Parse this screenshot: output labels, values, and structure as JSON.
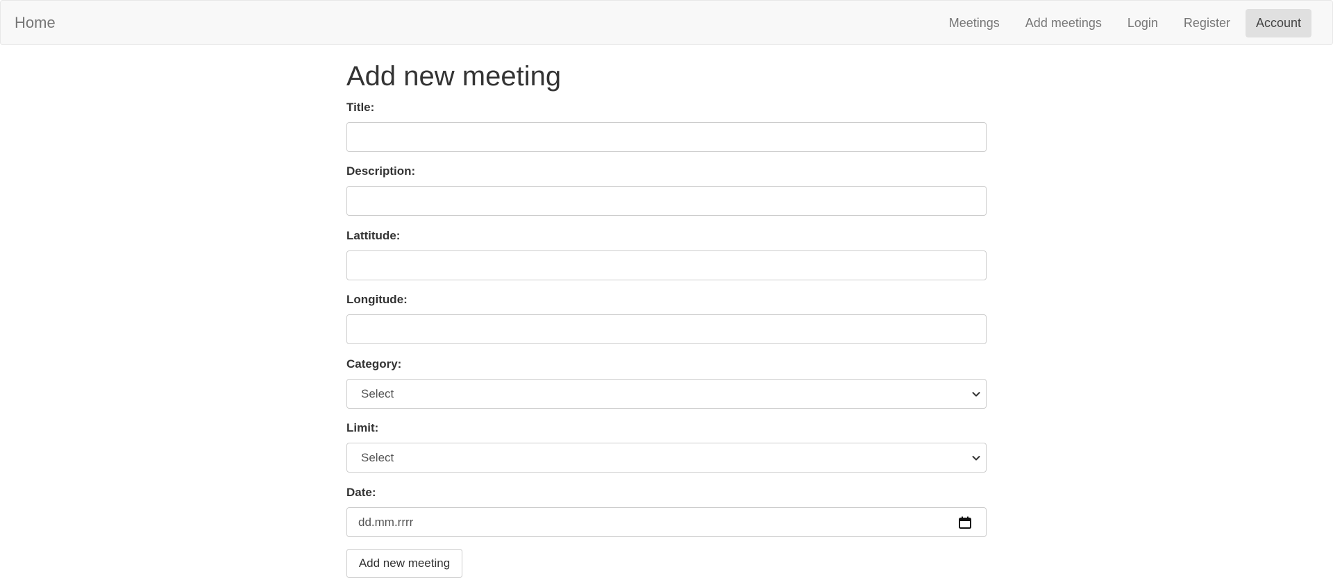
{
  "navbar": {
    "brand": "Home",
    "links": [
      {
        "label": "Meetings"
      },
      {
        "label": "Add meetings"
      },
      {
        "label": "Login"
      },
      {
        "label": "Register"
      },
      {
        "label": "Account",
        "active": true
      }
    ]
  },
  "form": {
    "heading": "Add new meeting",
    "fields": {
      "title": {
        "label": "Title:",
        "value": ""
      },
      "description": {
        "label": "Description:",
        "value": ""
      },
      "latitude": {
        "label": "Lattitude:",
        "value": ""
      },
      "longitude": {
        "label": "Longitude:",
        "value": ""
      },
      "category": {
        "label": "Category:",
        "selected": "Select"
      },
      "limit": {
        "label": "Limit:",
        "selected": "Select"
      },
      "date": {
        "label": "Date:",
        "placeholder": "dd.mm.rrrr"
      }
    },
    "submit_label": "Add new meeting"
  },
  "icons": {
    "select_chevron": "chevron-down-icon",
    "date_picker": "calendar-icon"
  },
  "colors": {
    "navbar_bg": "#f8f8f8",
    "active_link_bg": "#e0e0e0",
    "link_text": "#777777"
  }
}
